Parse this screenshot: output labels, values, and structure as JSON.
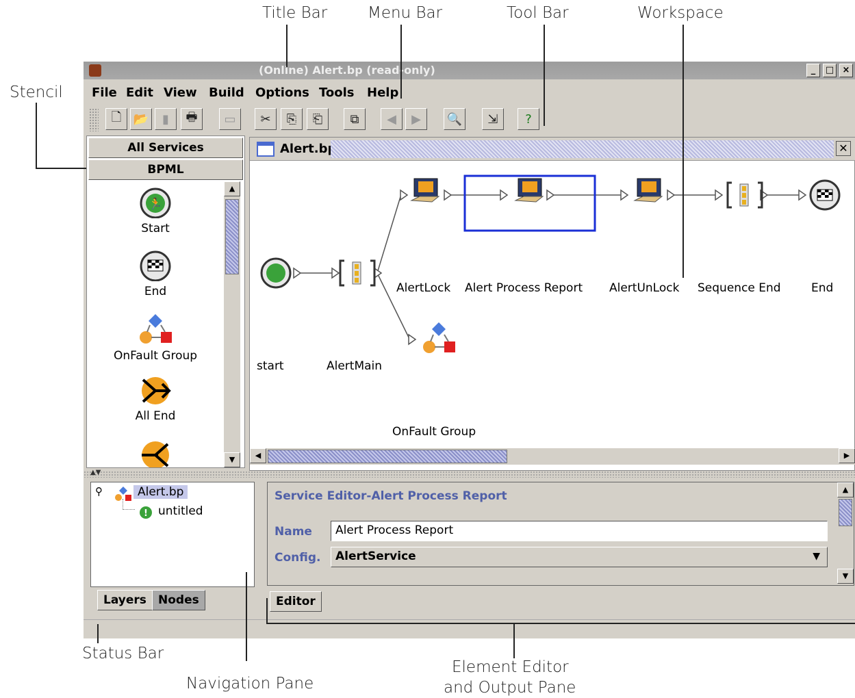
{
  "callouts": {
    "title_bar": "Title Bar",
    "menu_bar": "Menu Bar",
    "tool_bar": "Tool Bar",
    "workspace": "Workspace",
    "stencil": "Stencil",
    "status_bar": "Status Bar",
    "navigation_pane": "Navigation Pane",
    "editor_line1": "Element Editor",
    "editor_line2": "and Output Pane"
  },
  "window": {
    "title": "(Online) Alert.bp (read-only)",
    "min": "_",
    "max": "□",
    "close": "×"
  },
  "menu": {
    "file": "File",
    "edit": "Edit",
    "view": "View",
    "build": "Build",
    "options": "Options",
    "tools": "Tools",
    "help": "Help"
  },
  "stencil": {
    "all_services": "All Services",
    "bpml": "BPML",
    "items": [
      "Start",
      "End",
      "OnFault Group",
      "All End"
    ]
  },
  "workspace": {
    "tab_title": "Alert.bp",
    "nodes": {
      "start": "start",
      "alert_main": "AlertMain",
      "alert_lock": "AlertLock",
      "alert_process_report": "Alert Process Report",
      "alert_unlock": "AlertUnLock",
      "sequence_end": "Sequence End",
      "end": "End",
      "onfault_group": "OnFault Group"
    }
  },
  "navigation": {
    "root": "Alert.bp",
    "child": "untitled",
    "tabs": [
      "Layers",
      "Nodes"
    ]
  },
  "editor": {
    "title": "Service Editor-Alert Process Report",
    "name_label": "Name",
    "name_value": "Alert Process Report",
    "config_label": "Config.",
    "config_value": "AlertService",
    "tab": "Editor"
  },
  "colors": {
    "selection": "#1a2fd6",
    "editor_label": "#5060a8"
  }
}
